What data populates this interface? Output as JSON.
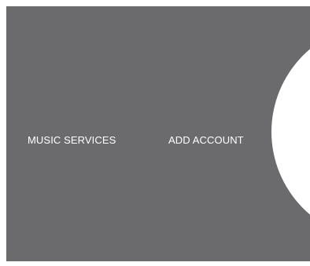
{
  "menu": {
    "items": [
      {
        "label": "MUSIC SERVICES"
      },
      {
        "label": "ADD ACCOUNT"
      }
    ]
  },
  "colors": {
    "panel_background": "#6b6b6d",
    "page_background": "#ffffff",
    "text": "#ffffff",
    "circle": "#ffffff"
  },
  "icons": {
    "circle": "selection-circle"
  }
}
